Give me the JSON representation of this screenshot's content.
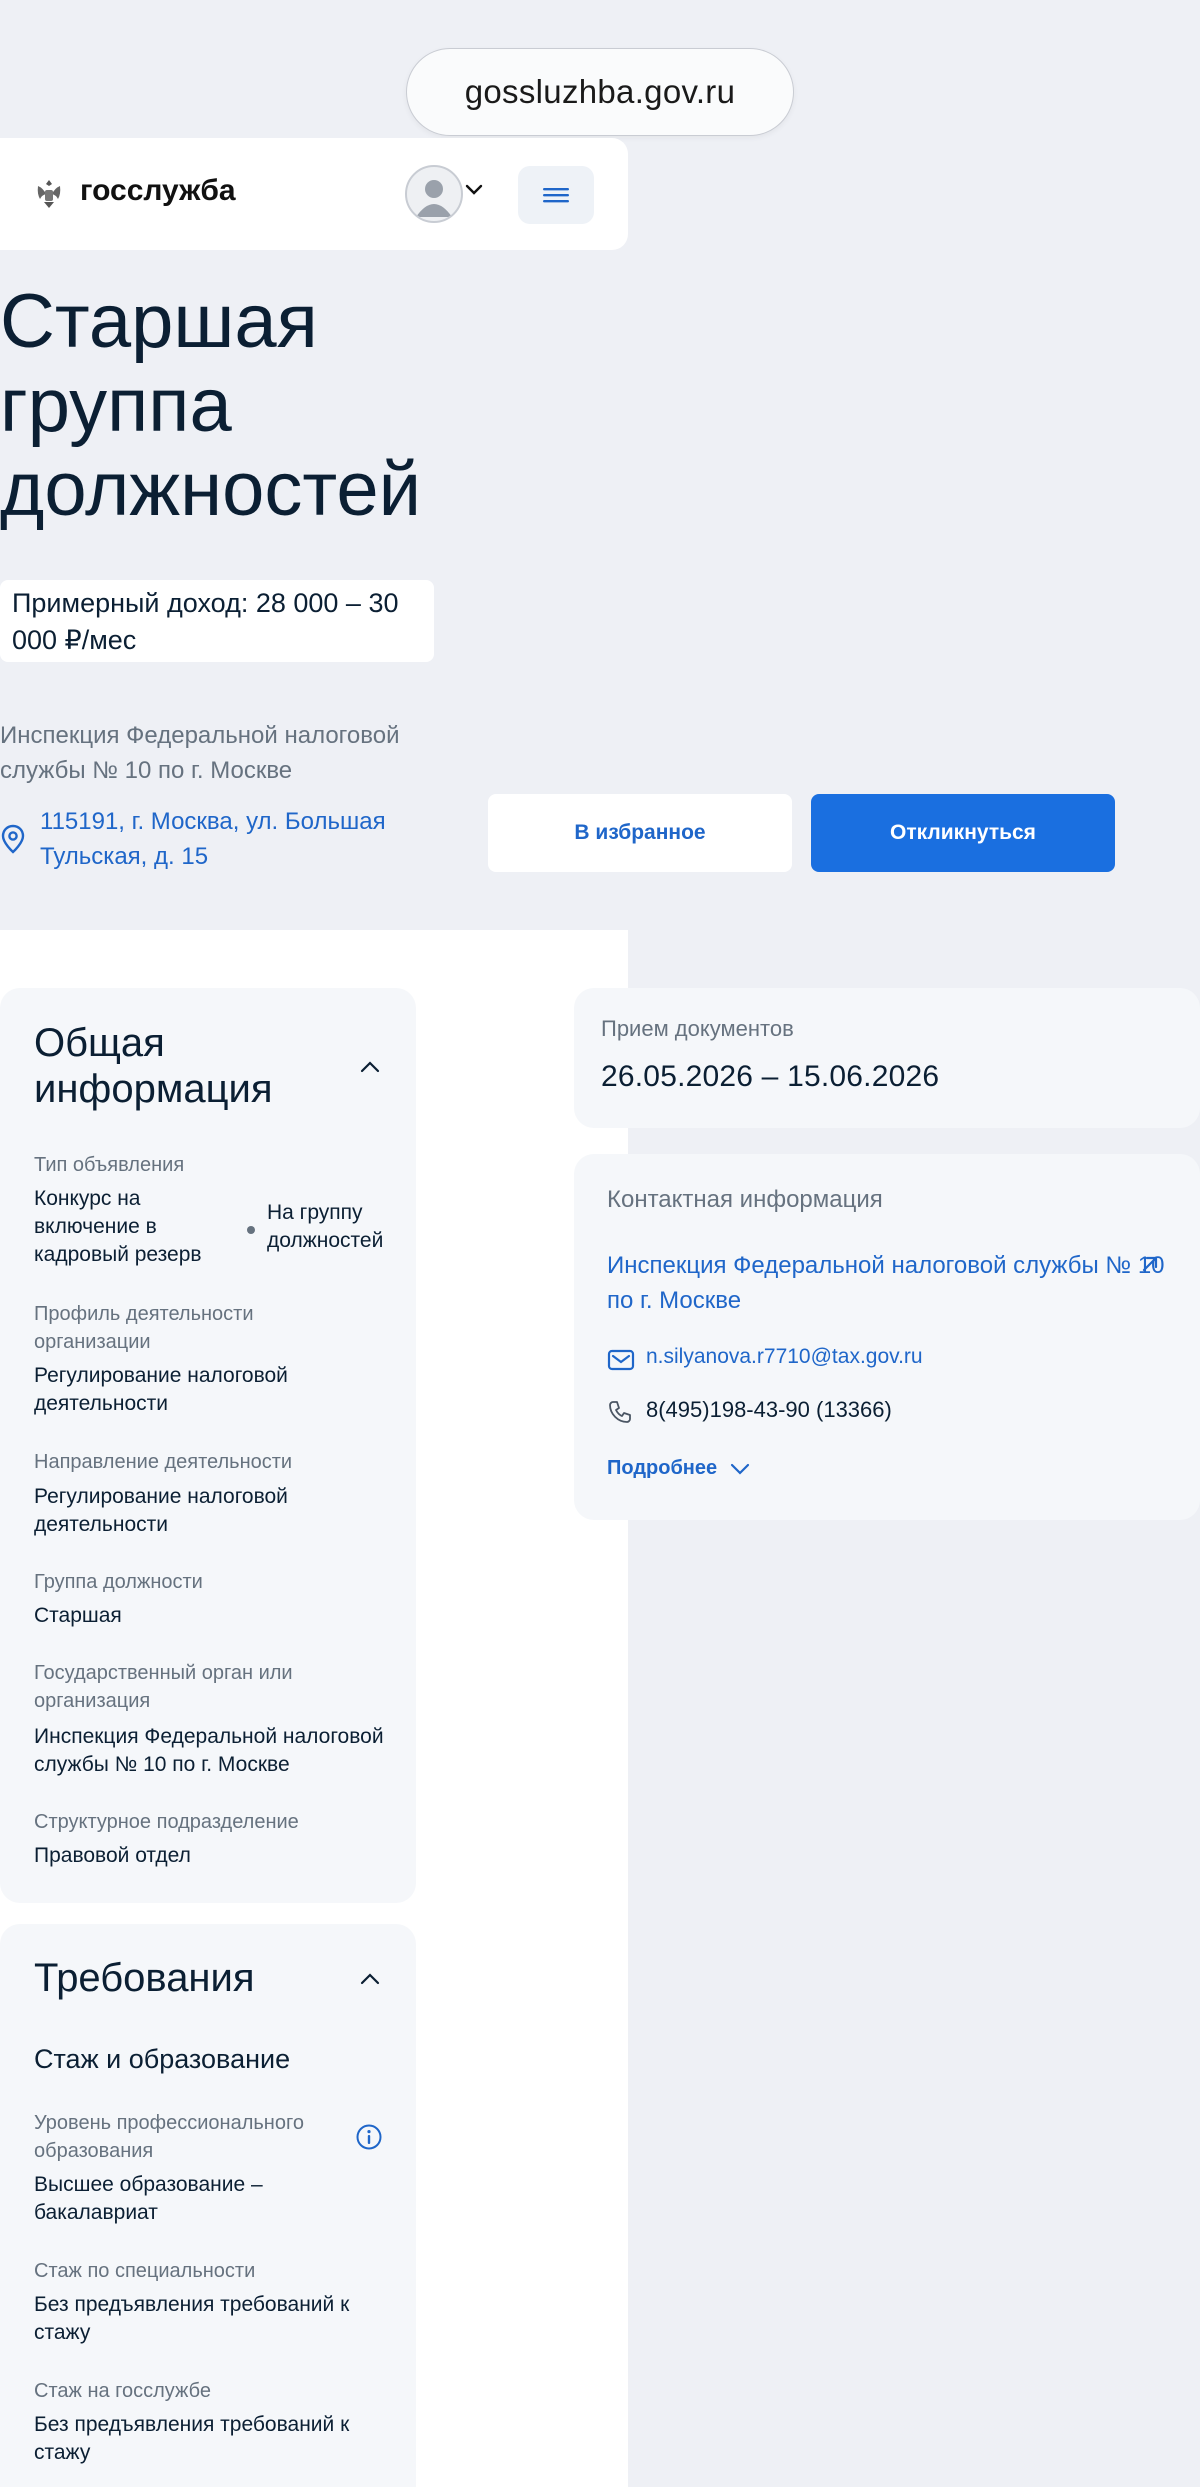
{
  "browser": {
    "url": "gossluzhba.gov.ru"
  },
  "header": {
    "logo_text": "госслужба",
    "emblem_icon": "coat-of-arms-icon",
    "avatar_icon": "user-avatar-icon",
    "menu_icon": "hamburger-menu-icon"
  },
  "vacancy": {
    "title": "Старшая группа должностей",
    "income": "Примерный доход: 28 000 – 30 000 ₽/мес",
    "org": "Инспекция Федеральной налоговой службы № 10 по г. Москве",
    "address": "115191, г. Москва, ул. Большая Тульская, д. 15"
  },
  "actions": {
    "favorite": "В избранное",
    "apply": "Откликнуться"
  },
  "general": {
    "title": "Общая информация",
    "ad_type_label": "Тип объявления",
    "ad_type_value_1": "Конкурс на включение в кадровый резерв",
    "ad_type_value_2": "На группу должностей",
    "profile_label": "Профиль деятельности организации",
    "profile_value": "Регулирование налоговой деятельности",
    "direction_label": "Направление деятельности",
    "direction_value": "Регулирование налоговой деятельности",
    "group_label": "Группа должности",
    "group_value": "Старшая",
    "gov_label": "Государственный орган или организация",
    "gov_value": "Инспекция Федеральной налоговой службы № 10 по г. Москве",
    "unit_label": "Структурное подразделение",
    "unit_value": "Правовой отдел"
  },
  "requirements": {
    "title": "Требования",
    "subtitle": "Стаж и образование",
    "edu_label": "Уровень профессионального образования",
    "edu_value": "Высшее образование – бакалавриат",
    "spec_label": "Стаж по специальности",
    "spec_value": "Без предъявления требований к стажу",
    "civil_label": "Стаж на госслужбе",
    "civil_value": "Без предъявления требований к стажу"
  },
  "documents": {
    "label": "Прием документов",
    "dates": "26.05.2026 – 15.06.2026"
  },
  "contact": {
    "title": "Контактная информация",
    "org": "Инспекция Федеральной налоговой службы № 10 по г. Москве",
    "email": "n.silyanova.r7710@tax.gov.ru",
    "phone": "8(495)198-43-90 (13366)",
    "more": "Подробнее"
  },
  "colors": {
    "accent": "#1a6fe0",
    "link": "#1f66c9",
    "background": "#eef0f5",
    "card": "#f5f7fa",
    "muted_text": "#66727f"
  }
}
